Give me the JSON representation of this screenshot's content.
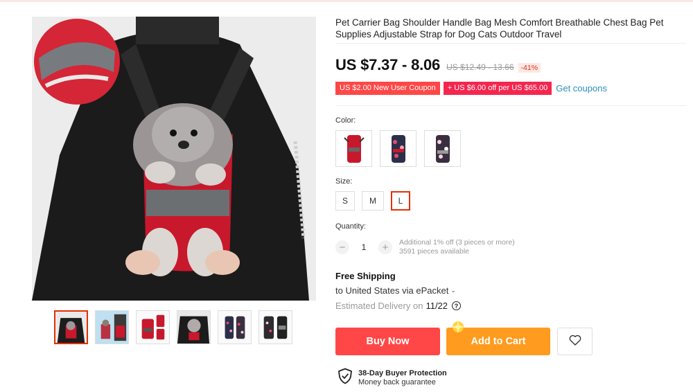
{
  "product": {
    "title": "Pet Carrier Bag Shoulder Handle Bag Mesh Comfort Breathable Chest Bag Pet Supplies Adjustable Strap for Dog Cats Outdoor Travel",
    "price": "US $7.37 - 8.06",
    "original_price": "US $12.49 - 13.66",
    "discount": "-41%"
  },
  "coupons": {
    "new_user": "US $2.00 New User Coupon",
    "store": "+ US $6.00 off per US $65.00",
    "link": "Get coupons"
  },
  "gallery": {
    "thumbnail_count": 6,
    "active_index": 0
  },
  "color": {
    "label": "Color:",
    "options": [
      "red",
      "floral-dark",
      "floral-light"
    ]
  },
  "size": {
    "label": "Size:",
    "options": [
      "S",
      "M",
      "L"
    ],
    "selected": "L"
  },
  "quantity": {
    "label": "Quantity:",
    "minus": "−",
    "value": "1",
    "plus": "+",
    "discount_info": "Additional 1% off (3 pieces or more)",
    "available": "3591 pieces available"
  },
  "shipping": {
    "title": "Free Shipping",
    "destination": "to United States via ePacket",
    "delivery_label": "Estimated Delivery on",
    "delivery_date": "11/22",
    "help": "?"
  },
  "actions": {
    "buy_now": "Buy Now",
    "add_to_cart": "Add to Cart"
  },
  "protection": {
    "title": "38-Day Buyer Protection",
    "subtitle": "Money back guarantee"
  },
  "colors": {
    "accent": "#ff4747",
    "cart": "#ff9b1f",
    "link": "#2a8fbd",
    "selected_border": "#e62e04"
  },
  "icons": {
    "help": "question-circle-icon",
    "wishlist": "heart-icon",
    "protection": "shield-check-icon",
    "dropdown": "chevron-down-icon"
  }
}
